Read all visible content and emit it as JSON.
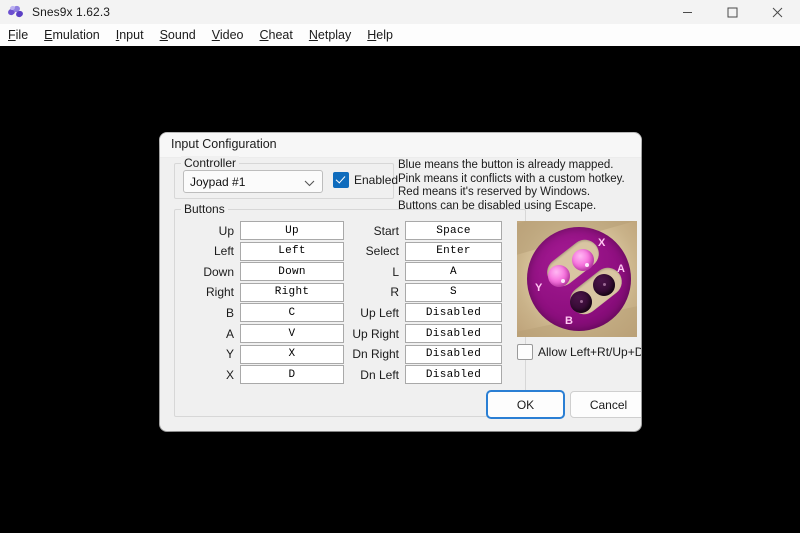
{
  "window": {
    "title": "Snes9x 1.62.3",
    "icon": "snes9x-logo-icon",
    "controls": {
      "minimize": "minimize-icon",
      "maximize": "maximize-icon",
      "close": "close-icon"
    },
    "menu": [
      {
        "label": "File",
        "accel": "F"
      },
      {
        "label": "Emulation",
        "accel": "E"
      },
      {
        "label": "Input",
        "accel": "I"
      },
      {
        "label": "Sound",
        "accel": "S"
      },
      {
        "label": "Video",
        "accel": "V"
      },
      {
        "label": "Cheat",
        "accel": "C"
      },
      {
        "label": "Netplay",
        "accel": "N"
      },
      {
        "label": "Help",
        "accel": "H"
      }
    ]
  },
  "dialog": {
    "title": "Input Configuration",
    "controller": {
      "group_label": "Controller",
      "selected": "Joypad #1",
      "enabled_label": "Enabled",
      "enabled_checked": true
    },
    "hints": [
      "Blue means the button is already mapped.",
      "Pink means it conflicts with a custom hotkey.",
      "Red means it's reserved by Windows.",
      "Buttons can be disabled using Escape."
    ],
    "buttons_group_label": "Buttons",
    "bindings_left": [
      {
        "label": "Up",
        "value": "Up"
      },
      {
        "label": "Left",
        "value": "Left"
      },
      {
        "label": "Down",
        "value": "Down"
      },
      {
        "label": "Right",
        "value": "Right"
      },
      {
        "label": "B",
        "value": "C"
      },
      {
        "label": "A",
        "value": "V"
      },
      {
        "label": "Y",
        "value": "X"
      },
      {
        "label": "X",
        "value": "D"
      }
    ],
    "bindings_right": [
      {
        "label": "Start",
        "value": "Space"
      },
      {
        "label": "Select",
        "value": "Enter"
      },
      {
        "label": "L",
        "value": "A"
      },
      {
        "label": "R",
        "value": "S"
      },
      {
        "label": "Up Left",
        "value": "Disabled"
      },
      {
        "label": "Up Right",
        "value": "Disabled"
      },
      {
        "label": "Dn Right",
        "value": "Disabled"
      },
      {
        "label": "Dn Left",
        "value": "Disabled"
      }
    ],
    "gamepad_image": {
      "name": "snes-face-buttons-image",
      "letters": {
        "x": "X",
        "y": "Y",
        "a": "A",
        "b": "B"
      }
    },
    "allow_diagonals": {
      "label": "Allow Left+Rt/Up+Dn",
      "checked": false
    },
    "ok_label": "OK",
    "cancel_label": "Cancel"
  },
  "colors": {
    "accent": "#0f6cbd",
    "focus_border": "#2a7fd4",
    "dialog_bg": "#f0f0f0",
    "pad_purple": "#8f0f80",
    "pad_lit": "#f875df"
  }
}
